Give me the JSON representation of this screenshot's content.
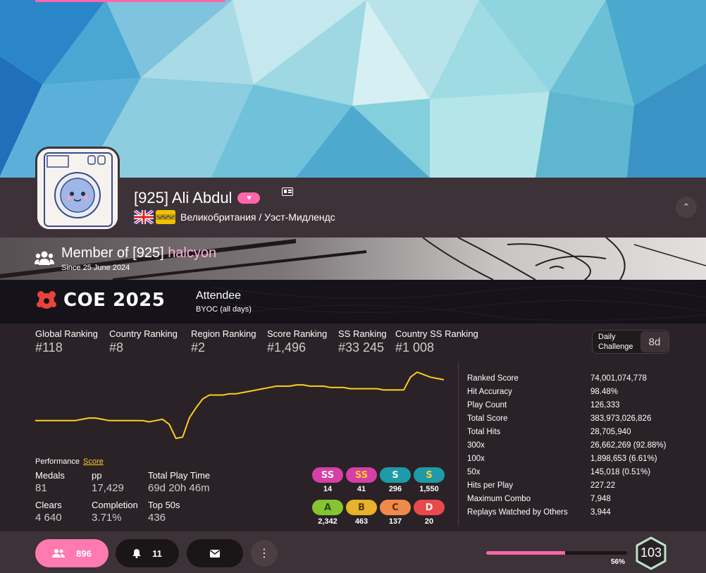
{
  "profile": {
    "username": "[925] Ali Abdul",
    "location": "Великобритания / Уэст-Мидлендс"
  },
  "team": {
    "prefix": "Member of [925]",
    "name": "halcyon",
    "since": "Since 25 June 2024"
  },
  "tournament": {
    "name": "COE 2025",
    "role": "Attendee",
    "detail": "BYOC (all days)"
  },
  "rankings": [
    {
      "label": "Global Ranking",
      "value": "#118"
    },
    {
      "label": "Country Ranking",
      "value": "#8"
    },
    {
      "label": "Region Ranking",
      "value": "#2"
    },
    {
      "label": "Score Ranking",
      "value": "#1,496"
    },
    {
      "label": "SS Ranking",
      "value": "#33 245"
    },
    {
      "label": "Country SS Ranking",
      "value": "#1 008"
    }
  ],
  "daily_challenge": {
    "label": "Daily Challenge",
    "value": "8d"
  },
  "details": [
    {
      "label": "Ranked Score",
      "value": "74,001,074,778"
    },
    {
      "label": "Hit Accuracy",
      "value": "98.48%"
    },
    {
      "label": "Play Count",
      "value": "126,333"
    },
    {
      "label": "Total Score",
      "value": "383,973,026,826"
    },
    {
      "label": "Total Hits",
      "value": "28,705,940"
    },
    {
      "label": "300x",
      "value": "26,662,269 (92.88%)"
    },
    {
      "label": "100x",
      "value": "1,898,653 (6.61%)"
    },
    {
      "label": "50x",
      "value": "145,018 (0.51%)"
    },
    {
      "label": "Hits per Play",
      "value": "227.22"
    },
    {
      "label": "Maximum Combo",
      "value": "7,948"
    },
    {
      "label": "Replays Watched by Others",
      "value": "3,944"
    }
  ],
  "performance": {
    "label": "Performance",
    "link": "Score"
  },
  "stats": [
    {
      "label": "Medals",
      "value": "81"
    },
    {
      "label": "pp",
      "value": "17,429"
    },
    {
      "label": "Total Play Time",
      "value": "69d 20h 46m"
    },
    {
      "label": "Clears",
      "value": "4 640"
    },
    {
      "label": "Completion",
      "value": "3.71%"
    },
    {
      "label": "Top 50s",
      "value": "436"
    }
  ],
  "grades": [
    {
      "grade": "SS",
      "count": "14",
      "bg": "#d63fa5",
      "fg": "#f4f4f4"
    },
    {
      "grade": "SS",
      "count": "41",
      "bg": "#d63fa5",
      "fg": "#ffd22e"
    },
    {
      "grade": "S",
      "count": "296",
      "bg": "#1e9aa8",
      "fg": "#f4f4f4"
    },
    {
      "grade": "S",
      "count": "1,550",
      "bg": "#1e9aa8",
      "fg": "#ffd22e"
    },
    {
      "grade": "A",
      "count": "2,342",
      "bg": "#84c531",
      "fg": "#2d4a12"
    },
    {
      "grade": "B",
      "count": "463",
      "bg": "#e8b22a",
      "fg": "#5a3e0a"
    },
    {
      "grade": "C",
      "count": "137",
      "bg": "#f08a4b",
      "fg": "#5a2a0a"
    },
    {
      "grade": "D",
      "count": "20",
      "bg": "#e8494a",
      "fg": "#f4f4f4"
    }
  ],
  "footer": {
    "followers": "896",
    "notifications": "11",
    "level_percent": "56%",
    "level": "103",
    "level_progress": 0.56
  },
  "colors": {
    "accent": "#ff66aa",
    "graph_line": "#ffcc22",
    "background": "#2a2226"
  },
  "icons": [
    "friends-icon",
    "bell-icon",
    "mail-icon",
    "more-icon",
    "chevron-up-icon",
    "id-card-icon",
    "heart-icon",
    "team-icon",
    "coe-logo-icon"
  ],
  "rank_history": [
    118,
    118,
    118,
    118,
    118,
    118,
    118,
    117,
    116,
    116,
    117,
    118,
    118,
    118,
    118,
    118,
    118,
    119,
    118,
    117,
    121,
    132,
    131,
    116,
    108,
    101,
    98,
    98,
    98,
    97,
    97,
    96,
    95,
    94,
    93,
    92,
    91,
    91,
    91,
    90,
    90,
    91,
    91,
    91,
    92,
    92,
    92,
    93,
    93,
    93,
    93,
    93,
    94,
    94,
    94,
    94,
    84,
    80,
    82,
    84,
    85,
    86
  ]
}
